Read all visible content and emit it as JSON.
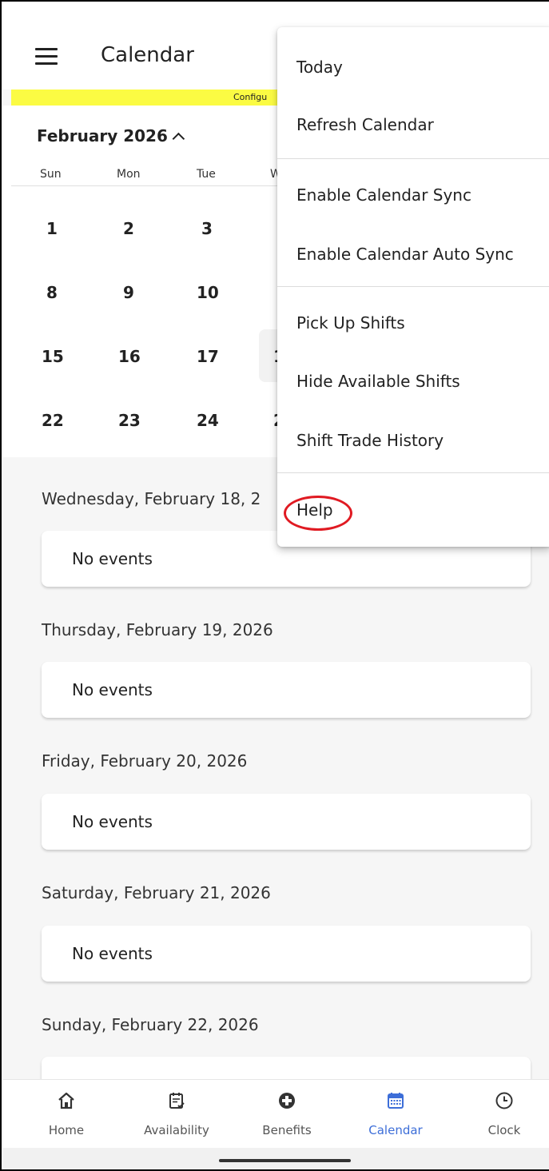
{
  "header": {
    "title": "Calendar",
    "banner_text": "Configu"
  },
  "calendar": {
    "month_label": "February 2026",
    "weekdays": [
      "Sun",
      "Mon",
      "Tue",
      "W"
    ],
    "weeks": [
      [
        "1",
        "2",
        "3",
        " "
      ],
      [
        "8",
        "9",
        "10",
        " "
      ],
      [
        "15",
        "16",
        "17",
        "1"
      ],
      [
        "22",
        "23",
        "24",
        "2"
      ]
    ]
  },
  "agenda": [
    {
      "date": "Wednesday, February 18, 2",
      "status": "No events"
    },
    {
      "date": "Thursday, February 19, 2026",
      "status": "No events"
    },
    {
      "date": "Friday, February 20, 2026",
      "status": "No events"
    },
    {
      "date": "Saturday, February 21, 2026",
      "status": "No events"
    },
    {
      "date": "Sunday, February 22, 2026",
      "status": ""
    }
  ],
  "menu": {
    "today": "Today",
    "refresh": "Refresh Calendar",
    "enable_sync": "Enable Calendar Sync",
    "enable_auto_sync": "Enable Calendar Auto Sync",
    "pick_up": "Pick Up Shifts",
    "hide_available": "Hide Available Shifts",
    "trade_history": "Shift Trade History",
    "help": "Help"
  },
  "bottom_nav": {
    "home": "Home",
    "availability": "Availability",
    "benefits": "Benefits",
    "calendar": "Calendar",
    "clock": "Clock",
    "active": "calendar",
    "active_color": "#3d6ed8",
    "icons": [
      "home-icon",
      "availability-icon",
      "benefits-icon",
      "calendar-icon",
      "clock-icon"
    ]
  },
  "colors": {
    "banner": "#fbfb43",
    "highlight_circle": "#e01a22"
  }
}
